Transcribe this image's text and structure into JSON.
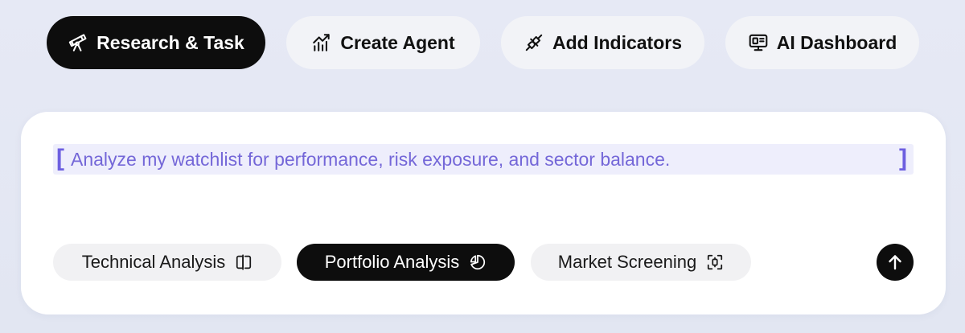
{
  "modes": [
    {
      "label": "Research & Task",
      "icon": "telescope-icon",
      "active": true
    },
    {
      "label": "Create Agent",
      "icon": "chart-growth-icon",
      "active": false
    },
    {
      "label": "Add Indicators",
      "icon": "plug-connect-icon",
      "active": false
    },
    {
      "label": "AI Dashboard",
      "icon": "monitor-dashboard-icon",
      "active": false
    }
  ],
  "composer": {
    "prompt_text": "Analyze my watchlist for performance, risk exposure, and sector balance.",
    "bracket_open": "[",
    "bracket_close": "]"
  },
  "chips": [
    {
      "label": "Technical Analysis",
      "icon": "split-panel-icon",
      "active": false
    },
    {
      "label": "Portfolio Analysis",
      "icon": "pie-chart-icon",
      "active": true
    },
    {
      "label": "Market Screening",
      "icon": "scan-focus-icon",
      "active": false
    }
  ],
  "send": {
    "icon": "arrow-up-icon"
  },
  "colors": {
    "background": "#e4e8f4",
    "active_pill": "#0d0d0d",
    "inactive_pill": "#f2f3f7",
    "prompt_highlight": "#eeeefc",
    "prompt_text": "#7467d8",
    "bracket": "#6d5fe0"
  }
}
